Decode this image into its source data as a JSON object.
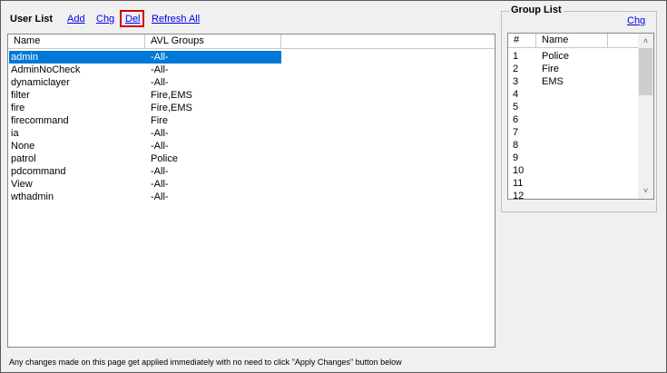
{
  "user_list": {
    "title": "User List",
    "actions": {
      "add": "Add",
      "chg": "Chg",
      "del": "Del",
      "refresh": "Refresh All"
    },
    "columns": [
      "Name",
      "AVL Groups"
    ],
    "rows": [
      {
        "name": "admin",
        "groups": "-All-",
        "selected": true
      },
      {
        "name": "AdminNoCheck",
        "groups": "-All-"
      },
      {
        "name": "dynamiclayer",
        "groups": "-All-"
      },
      {
        "name": "filter",
        "groups": "Fire,EMS"
      },
      {
        "name": "fire",
        "groups": "Fire,EMS"
      },
      {
        "name": "firecommand",
        "groups": "Fire"
      },
      {
        "name": "ia",
        "groups": "-All-"
      },
      {
        "name": "None",
        "groups": "-All-"
      },
      {
        "name": "patrol",
        "groups": "Police"
      },
      {
        "name": "pdcommand",
        "groups": "-All-"
      },
      {
        "name": "View",
        "groups": "-All-"
      },
      {
        "name": "wthadmin",
        "groups": "-All-"
      }
    ]
  },
  "group_list": {
    "title": "Group List",
    "chg": "Chg",
    "columns": [
      "#",
      "Name"
    ],
    "rows": [
      {
        "num": "1",
        "name": "Police"
      },
      {
        "num": "2",
        "name": "Fire"
      },
      {
        "num": "3",
        "name": "EMS"
      },
      {
        "num": "4",
        "name": ""
      },
      {
        "num": "5",
        "name": ""
      },
      {
        "num": "6",
        "name": ""
      },
      {
        "num": "7",
        "name": ""
      },
      {
        "num": "8",
        "name": ""
      },
      {
        "num": "9",
        "name": ""
      },
      {
        "num": "10",
        "name": ""
      },
      {
        "num": "11",
        "name": ""
      },
      {
        "num": "12",
        "name": ""
      }
    ]
  },
  "footer_note": "Any changes made on this page get applied immediately with no need to click \"Apply Changes\" button below",
  "colors": {
    "selection": "#0078d7",
    "highlight_box": "#d40000",
    "link": "#0000ee"
  }
}
